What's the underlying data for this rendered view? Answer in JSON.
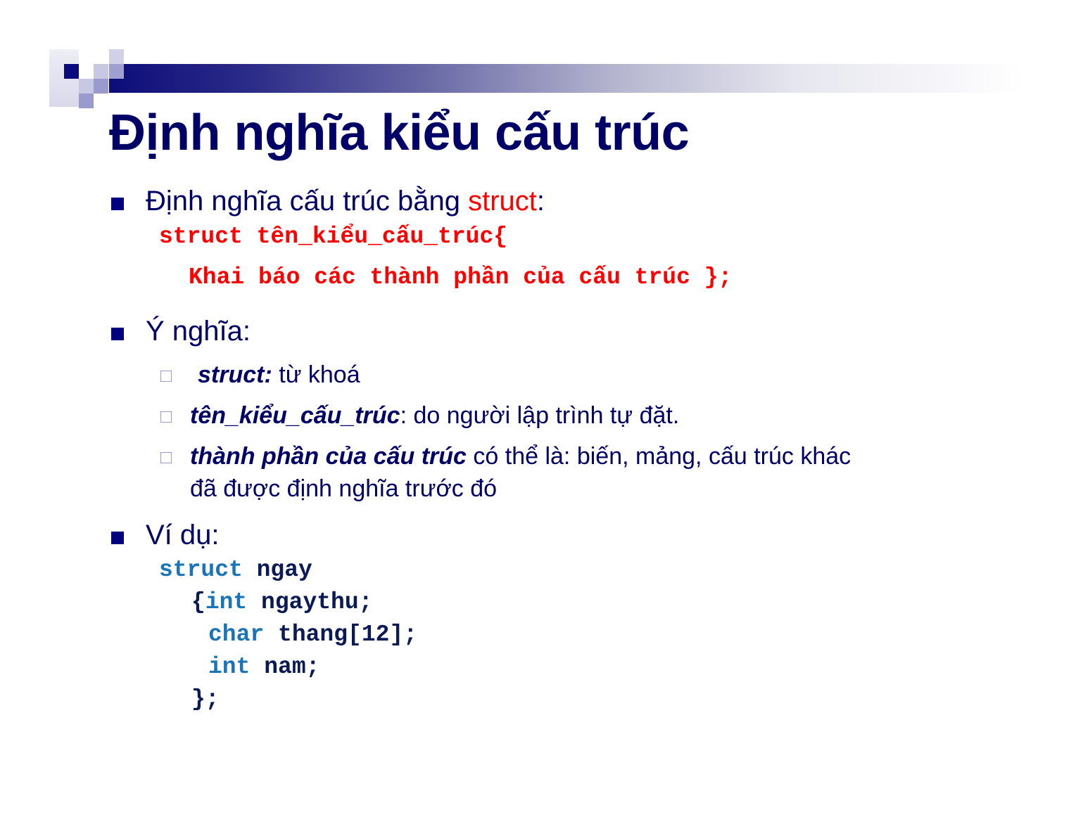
{
  "slide": {
    "title": "Định nghĩa kiểu cấu trúc",
    "bullets": {
      "def": {
        "text": "Định nghĩa cấu trúc bằng ",
        "keyword": "struct",
        "suffix": ":",
        "code_line1": "struct tên_kiểu_cấu_trúc{",
        "code_line2": "Khai báo các thành phần của cấu trúc };"
      },
      "meaning": {
        "text": "Ý nghĩa:",
        "items": [
          {
            "term": "struct:",
            "desc": " từ khoá"
          },
          {
            "term": "tên_kiểu_cấu_trúc",
            "desc": ": do người lập trình tự đặt."
          },
          {
            "term": "thành phần của cấu trúc",
            "desc": " có thể là: biến, mảng, cấu trúc khác",
            "desc2": "đã được định nghĩa trước đó"
          }
        ]
      },
      "example": {
        "text": "Ví dụ:",
        "code": {
          "l1_kw": "struct",
          "l1_rest": " ngay",
          "l2_brace": "{",
          "l2_kw": "int",
          "l2_rest": " ngaythu;",
          "l3_kw": "char",
          "l3_rest": " thang[12];",
          "l4_kw": "int",
          "l4_rest": " nam;",
          "l5": "};"
        }
      }
    }
  }
}
